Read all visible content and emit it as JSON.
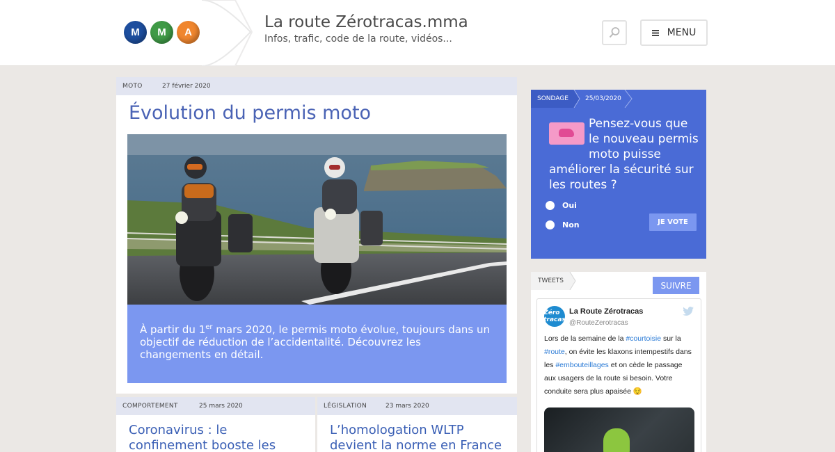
{
  "header": {
    "logo_letters": [
      "M",
      "M",
      "A"
    ],
    "site_title": "La route Zérotracas.mma",
    "site_subtitle": "Infos, trafic, code de la route, vidéos...",
    "menu_label": "MENU"
  },
  "featured": {
    "category": "MOTO",
    "date": "27 février 2020",
    "title": "Évolution du permis moto",
    "lead_before": "À partir du 1",
    "lead_sup": "er",
    "lead_after": " mars 2020, le permis moto évolue, toujours dans un objectif de réduction de l’accidentalité. Découvrez les changements en détail."
  },
  "cards": [
    {
      "category": "COMPORTEMENT",
      "date": "25 mars 2020",
      "title": "Coronavirus : le confinement booste les"
    },
    {
      "category": "LÉGISLATION",
      "date": "23 mars 2020",
      "title": "L’homologation WLTP devient la norme en France"
    }
  ],
  "poll": {
    "tag": "SONDAGE",
    "date": "25/03/2020",
    "question": "Pensez-vous que le nouveau permis moto puisse améliorer la sécurité sur les routes ?",
    "options": [
      "Oui",
      "Non"
    ],
    "vote_label": "JE VOTE"
  },
  "tweets": {
    "tag": "TWEETS",
    "follow_label": "SUIVRE",
    "tweet": {
      "avatar_text": "Zéro tracas",
      "name": "La Route Zérotracas",
      "handle": "@RouteZerotracas",
      "text_parts": [
        "Lors de la semaine de la ",
        "#courtoisie",
        " sur la ",
        "#route",
        ", on évite les klaxons intempestifs dans les ",
        "#embouteillages",
        " et on cède le passage aux usagers de la route si besoin. Votre conduite sera plus apaisée 😌"
      ]
    }
  },
  "colors": {
    "accent_blue": "#4a6bd6",
    "light_blue": "#7b97f0",
    "title_blue": "#4a63b5",
    "tag_bg": "#e2e5f1",
    "page_bg": "#ebe8e5"
  }
}
